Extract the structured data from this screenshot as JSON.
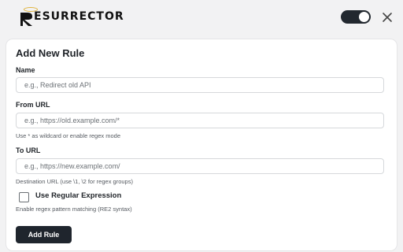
{
  "app": {
    "logo_text": "ESURRECTOR"
  },
  "header": {
    "toggle_state": "on",
    "close_icon": "close-icon"
  },
  "form": {
    "title": "Add New Rule",
    "name": {
      "label": "Name",
      "placeholder": "e.g., Redirect old API",
      "value": ""
    },
    "from_url": {
      "label": "From URL",
      "placeholder": "e.g., https://old.example.com/*",
      "value": "",
      "help": "Use * as wildcard or enable regex mode"
    },
    "to_url": {
      "label": "To URL",
      "placeholder": "e.g., https://new.example.com/",
      "value": "",
      "help": "Destination URL (use \\1, \\2 for regex groups)"
    },
    "regex": {
      "label": "Use Regular Expression",
      "checked": false,
      "help": "Enable regex pattern matching (RE2 syntax)"
    },
    "submit_label": "Add Rule"
  },
  "colors": {
    "accent": "#1f252d",
    "halo": "#e0b23a",
    "background": "#f2f2f3"
  }
}
